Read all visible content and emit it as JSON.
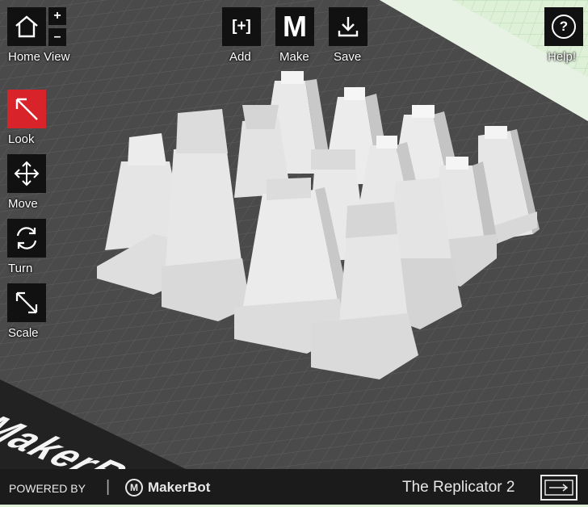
{
  "toolbar": {
    "home_label": "Home View",
    "zoom_in": "+",
    "zoom_out": "–",
    "add_label": "Add",
    "add_glyph": "[+]",
    "make_label": "Make",
    "make_glyph": "M",
    "save_label": "Save",
    "help_label": "Help!",
    "help_glyph": "?"
  },
  "tools": [
    {
      "label": "Look",
      "icon": "look-arrow-icon",
      "active": true
    },
    {
      "label": "Move",
      "icon": "move-arrows-icon",
      "active": false
    },
    {
      "label": "Turn",
      "icon": "rotate-icon",
      "active": false
    },
    {
      "label": "Scale",
      "icon": "scale-arrow-icon",
      "active": false
    }
  ],
  "build_plate": {
    "logo_text": "MakerBot"
  },
  "footer": {
    "powered_by": "POWERED BY",
    "separator": "|",
    "brand": "MakerBot",
    "brand_mark": "M",
    "printer_name": "The Replicator 2"
  },
  "colors": {
    "active_tool": "#d9232a",
    "toolbar_button": "#111111",
    "plate": "#4a4a4a",
    "background_grid": "#dff0d8",
    "footer": "#1b1b1b"
  }
}
